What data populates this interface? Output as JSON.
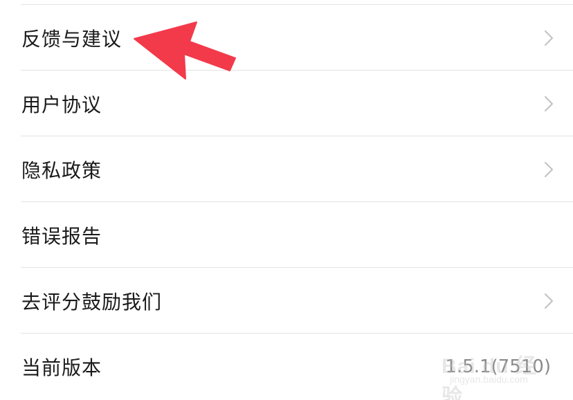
{
  "settings": {
    "items": [
      {
        "label": "反馈与建议",
        "has_chevron": true
      },
      {
        "label": "用户协议",
        "has_chevron": true
      },
      {
        "label": "隐私政策",
        "has_chevron": true
      },
      {
        "label": "错误报告",
        "has_chevron": false
      },
      {
        "label": "去评分鼓励我们",
        "has_chevron": true
      },
      {
        "label": "当前版本",
        "value": "1.5.1(7510)",
        "has_chevron": false
      }
    ]
  },
  "annotation": {
    "arrow_color": "#f23a4b",
    "points_to": "反馈与建议"
  },
  "watermark": {
    "brand": "Bai du 经验",
    "sub": "jingyan.baidu.com"
  },
  "colors": {
    "divider": "#e3e3e3",
    "label": "#1a1a1a",
    "chevron": "#c4c4c4",
    "value": "#8a8a8a"
  }
}
